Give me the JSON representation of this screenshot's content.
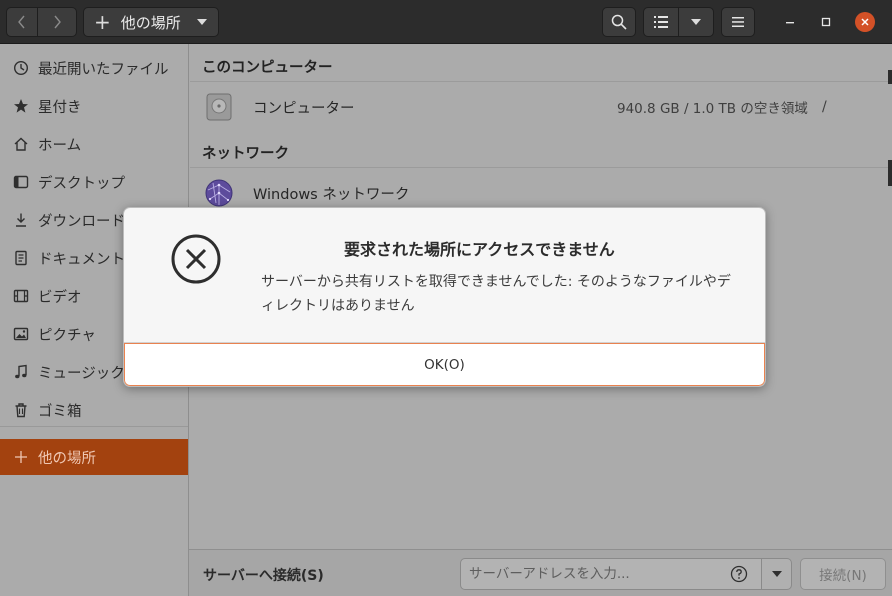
{
  "header": {
    "location_label": "他の場所",
    "icons": [
      "go-back-icon",
      "go-forward-icon",
      "plus-icon",
      "chevron-down-icon",
      "search-icon",
      "list-view-icon",
      "chevron-down-icon",
      "hamburger-menu-icon",
      "minimize-icon",
      "maximize-icon",
      "close-icon"
    ],
    "close_color": "#d35127"
  },
  "sidebar": {
    "items": [
      {
        "label": "最近開いたファイル",
        "icon": "recent-icon"
      },
      {
        "label": "星付き",
        "icon": "star-icon"
      },
      {
        "label": "ホーム",
        "icon": "home-icon"
      },
      {
        "label": "デスクトップ",
        "icon": "desktop-icon"
      },
      {
        "label": "ダウンロード",
        "icon": "download-icon"
      },
      {
        "label": "ドキュメント",
        "icon": "document-icon"
      },
      {
        "label": "ビデオ",
        "icon": "video-icon"
      },
      {
        "label": "ピクチャ",
        "icon": "picture-icon"
      },
      {
        "label": "ミュージック",
        "icon": "music-icon"
      },
      {
        "label": "ゴミ箱",
        "icon": "trash-icon"
      }
    ],
    "other_locations": {
      "label": "他の場所",
      "icon": "plus-icon",
      "active": true
    },
    "active_color": "#a3420f"
  },
  "main": {
    "this_computer_header": "このコンピューター",
    "computer": {
      "name": "コンピューター",
      "info": "940.8 GB / 1.0 TB の空き領域",
      "path": "/"
    },
    "network_header": "ネットワーク",
    "network": {
      "name": "Windows ネットワーク"
    }
  },
  "bottom": {
    "connect_label": "サーバーへ接続(S)",
    "server_placeholder": "サーバーアドレスを入力...",
    "connect_button": "接続(N)"
  },
  "dialog": {
    "title": "要求された場所にアクセスできません",
    "message": "サーバーから共有リストを取得できませんでした: そのようなファイルやディレクトリはありません",
    "ok_button": "OK(O)",
    "icon": "error-circle-x-icon",
    "focus_color": "#e9824f"
  }
}
